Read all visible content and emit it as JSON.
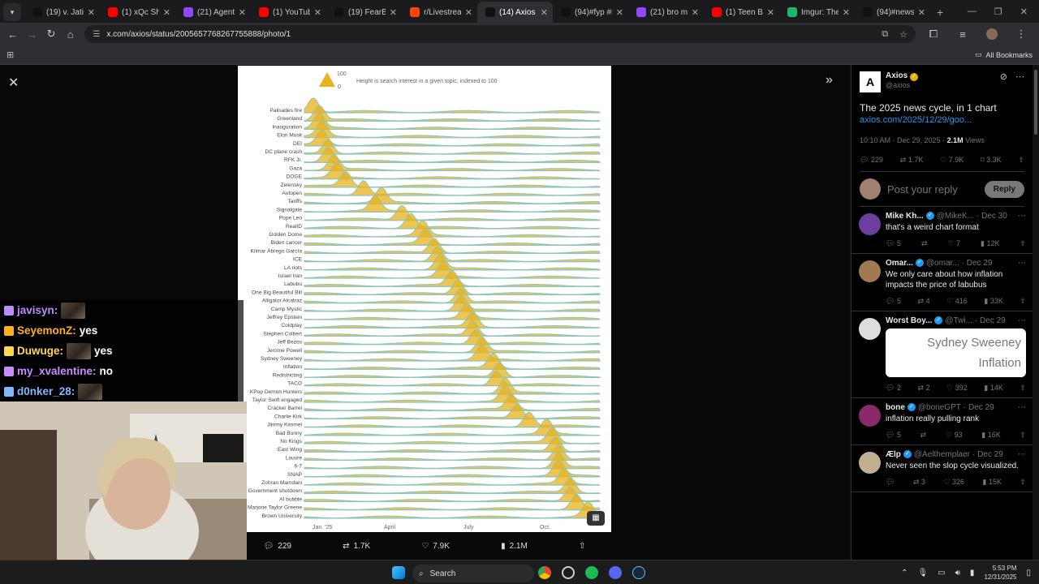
{
  "tabs": [
    {
      "label": "(19) v. Jatin",
      "icon": "x-logo",
      "color": "#111111"
    },
    {
      "label": "(1) xQc Shar",
      "icon": "youtube-logo",
      "color": "#ff0000"
    },
    {
      "label": "(21) Agent n",
      "icon": "twitch-logo",
      "color": "#9146ff"
    },
    {
      "label": "(1) YouTube",
      "icon": "youtube-logo",
      "color": "#ff0000"
    },
    {
      "label": "(19) FearBuc",
      "icon": "x-logo",
      "color": "#111111"
    },
    {
      "label": "r/Livestream",
      "icon": "reddit-logo",
      "color": "#ff4500"
    },
    {
      "label": "(14) Axios o",
      "icon": "x-logo",
      "color": "#111111",
      "active": true
    },
    {
      "label": "(94)#fyp #n",
      "icon": "tiktok-logo",
      "color": "#111111"
    },
    {
      "label": "(21) bro mix",
      "icon": "twitch-logo",
      "color": "#9146ff"
    },
    {
      "label": "(1) Teen Bus",
      "icon": "youtube-logo",
      "color": "#ff0000"
    },
    {
      "label": "Imgur: The n",
      "icon": "imgur-logo",
      "color": "#1bb76e"
    },
    {
      "label": "(94)#newsre",
      "icon": "tiktok-logo",
      "color": "#111111"
    }
  ],
  "address": {
    "url": "x.com/axios/status/2005657768267755888/photo/1"
  },
  "bookmarks": {
    "all_label": "All Bookmarks"
  },
  "chart_data": {
    "type": "area",
    "title": "",
    "legend_note": "Height is search interest in a given topic, indexed to 100",
    "legend_scale": [
      "100",
      "0"
    ],
    "x_ticks": [
      "Jan. '25",
      "April",
      "July",
      "Oct."
    ],
    "colors": {
      "ridge": "#e8b21a",
      "base": "#8ec5b8"
    },
    "topics": [
      {
        "name": "Palisades fire",
        "peak": 0.03
      },
      {
        "name": "Greenland",
        "peak": 0.05
      },
      {
        "name": "Inauguration",
        "peak": 0.05
      },
      {
        "name": "Elon Musk",
        "peak": 0.06
      },
      {
        "name": "DEI",
        "peak": 0.06
      },
      {
        "name": "DC plane crash",
        "peak": 0.08
      },
      {
        "name": "RFK Jr.",
        "peak": 0.08
      },
      {
        "name": "Gaza",
        "peak": 0.1
      },
      {
        "name": "DOGE",
        "peak": 0.11
      },
      {
        "name": "Zelensky",
        "peak": 0.14
      },
      {
        "name": "Autopen",
        "peak": 0.2
      },
      {
        "name": "Tariffs",
        "peak": 0.26
      },
      {
        "name": "Signalgate",
        "peak": 0.24
      },
      {
        "name": "Pope Leo",
        "peak": 0.33
      },
      {
        "name": "RealID",
        "peak": 0.36
      },
      {
        "name": "Golden Dome",
        "peak": 0.4
      },
      {
        "name": "Biden cancer",
        "peak": 0.41
      },
      {
        "name": "Kilmar Ábrego García",
        "peak": 0.44
      },
      {
        "name": "ICE",
        "peak": 0.45
      },
      {
        "name": "LA riots",
        "peak": 0.46
      },
      {
        "name": "Israel Iran",
        "peak": 0.47
      },
      {
        "name": "Labubu",
        "peak": 0.5
      },
      {
        "name": "One Big Beautiful Bill",
        "peak": 0.52
      },
      {
        "name": "Alligator Alcatraz",
        "peak": 0.53
      },
      {
        "name": "Camp Mystic",
        "peak": 0.53
      },
      {
        "name": "Jeffrey Epstein",
        "peak": 0.55
      },
      {
        "name": "Coldplay",
        "peak": 0.57
      },
      {
        "name": "Stephen Colbert",
        "peak": 0.57
      },
      {
        "name": "Jeff Bezos",
        "peak": 0.58
      },
      {
        "name": "Jerome Powell",
        "peak": 0.6
      },
      {
        "name": "Sydney Sweeney",
        "peak": 0.6
      },
      {
        "name": "Inflation",
        "peak": 0.64
      },
      {
        "name": "Redistricting",
        "peak": 0.66
      },
      {
        "name": "TACO",
        "peak": 0.65
      },
      {
        "name": "KPop Demon Hunters",
        "peak": 0.68
      },
      {
        "name": "Taylor Swift engaged",
        "peak": 0.68
      },
      {
        "name": "Cracker Barrel",
        "peak": 0.7
      },
      {
        "name": "Charlie Kirk",
        "peak": 0.72
      },
      {
        "name": "Jimmy Kimmel",
        "peak": 0.76
      },
      {
        "name": "Bad Bunny",
        "peak": 0.82
      },
      {
        "name": "No Kings",
        "peak": 0.84
      },
      {
        "name": "East Wing",
        "peak": 0.85
      },
      {
        "name": "Louvre",
        "peak": 0.86
      },
      {
        "name": "6-7",
        "peak": 0.86
      },
      {
        "name": "SNAP",
        "peak": 0.86
      },
      {
        "name": "Zohran Mamdani",
        "peak": 0.88
      },
      {
        "name": "Government shutdown",
        "peak": 0.9
      },
      {
        "name": "AI bubble",
        "peak": 0.9
      },
      {
        "name": "Marjorie Taylor Greene",
        "peak": 0.92
      },
      {
        "name": "Brown University",
        "peak": 0.96
      }
    ]
  },
  "viewer_actions": {
    "replies": "229",
    "reposts": "1.7K",
    "likes": "7.9K",
    "views": "2.1M"
  },
  "chat": [
    {
      "user": "javisyn:",
      "text": "",
      "color": "#b98cff"
    },
    {
      "user": "SeyemonZ:",
      "text": "yes",
      "color": "#ffb020"
    },
    {
      "user": "Duwuge:",
      "text": "yes",
      "color": "#ffd84a"
    },
    {
      "user": "my_xvalentine:",
      "text": "no",
      "color": "#c48cff"
    },
    {
      "user": "d0nker_28:",
      "text": "",
      "color": "#7fb8ff"
    }
  ],
  "post": {
    "author": "Axios",
    "handle": "@axios",
    "text": "The 2025 news cycle, in 1 chart",
    "link": "axios.com/2025/12/29/goo...",
    "time": "10:10 AM · Dec 29, 2025 · ",
    "views_num": "2.1M",
    "views_label": " Views",
    "replies": "229",
    "reposts": "1.7K",
    "likes": "7.9K",
    "bookmarks": "3.3K",
    "reply_placeholder": "Post your reply",
    "reply_button": "Reply"
  },
  "replies": [
    {
      "name": "Mike Kh...",
      "handle": "@MikeK...",
      "date": "· Dec 30",
      "text": "that's a weird chart format",
      "r": "5",
      "rt": "",
      "l": "7",
      "v": "12K",
      "avatar": "#6b3fa0"
    },
    {
      "name": "Omar...",
      "handle": "@omar...",
      "date": "· Dec 29",
      "text": "We only care about how inflation impacts the price of labubus",
      "r": "5",
      "rt": "4",
      "l": "416",
      "v": "33K",
      "avatar": "#a07a50"
    },
    {
      "name": "Worst Boy...",
      "handle": "@Twi...",
      "date": "· Dec 29",
      "text": "",
      "image_text": [
        "Sydney Sweeney",
        "Inflation"
      ],
      "r": "2",
      "rt": "2",
      "l": "392",
      "v": "14K",
      "avatar": "#dddddd"
    },
    {
      "name": "bone",
      "handle": "@boneGPT",
      "date": "· Dec 29",
      "text": "inflation really pulling rank",
      "r": "5",
      "rt": "",
      "l": "93",
      "v": "16K",
      "avatar": "#8a2a6a"
    },
    {
      "name": "Ælp",
      "handle": "@Aelthemplaer",
      "date": "· Dec 29",
      "text": "Never seen the slop cycle visualized.",
      "r": "",
      "rt": "3",
      "l": "326",
      "v": "15K",
      "avatar": "#c0b090"
    }
  ],
  "taskbar": {
    "search": "Search",
    "time": "5:53 PM",
    "date": "12/31/2025"
  }
}
